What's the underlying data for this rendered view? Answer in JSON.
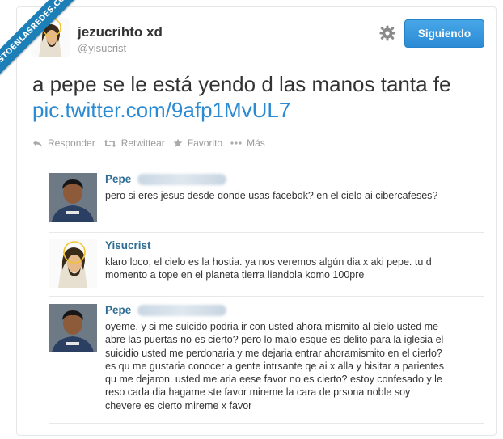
{
  "watermark": {
    "text": "VISTOENLASREDES.COM"
  },
  "tweet": {
    "author_name": "jezucrihto xd",
    "author_handle": "@yisucrist",
    "follow_label": "Siguiendo",
    "text": "a pepe se le está yendo d las manos tanta fe ",
    "link": "pic.twitter.com/9afp1MvUL7"
  },
  "actions": [
    {
      "label": "Responder",
      "icon": "reply-icon"
    },
    {
      "label": "Retwittear",
      "icon": "retweet-icon"
    },
    {
      "label": "Favorito",
      "icon": "star-icon"
    },
    {
      "label": "Más",
      "icon": "more-icon"
    }
  ],
  "replies": [
    {
      "name": "Pepe",
      "text": "pero si eres jesus desde donde usas facebok? en el cielo ai cibercafeses?"
    },
    {
      "name": "Yisucrist",
      "text": "klaro loco, el cielo es la hostia. ya nos veremos algún dia x aki pepe. tu d momento a tope en el planeta tierra liandola komo 100pre"
    },
    {
      "name": "Pepe",
      "text": "oyeme, y si me suicido podria ir con usted ahora mismito al cielo usted me abre las puertas no es cierto? pero lo malo esque es delito para la iglesia el suicidio usted me perdonaria y me dejaria entrar ahoramismito en el cierlo? es qu me gustaria conocer a gente intrsante qe ai x alla y bisitar a parientes qu me dejaron. usted me aria eese favor no es cierto? estoy confesado y le reso cada dia hagame ste favor mireme la cara de prsona noble soy chevere es cierto mireme x favor"
    }
  ]
}
